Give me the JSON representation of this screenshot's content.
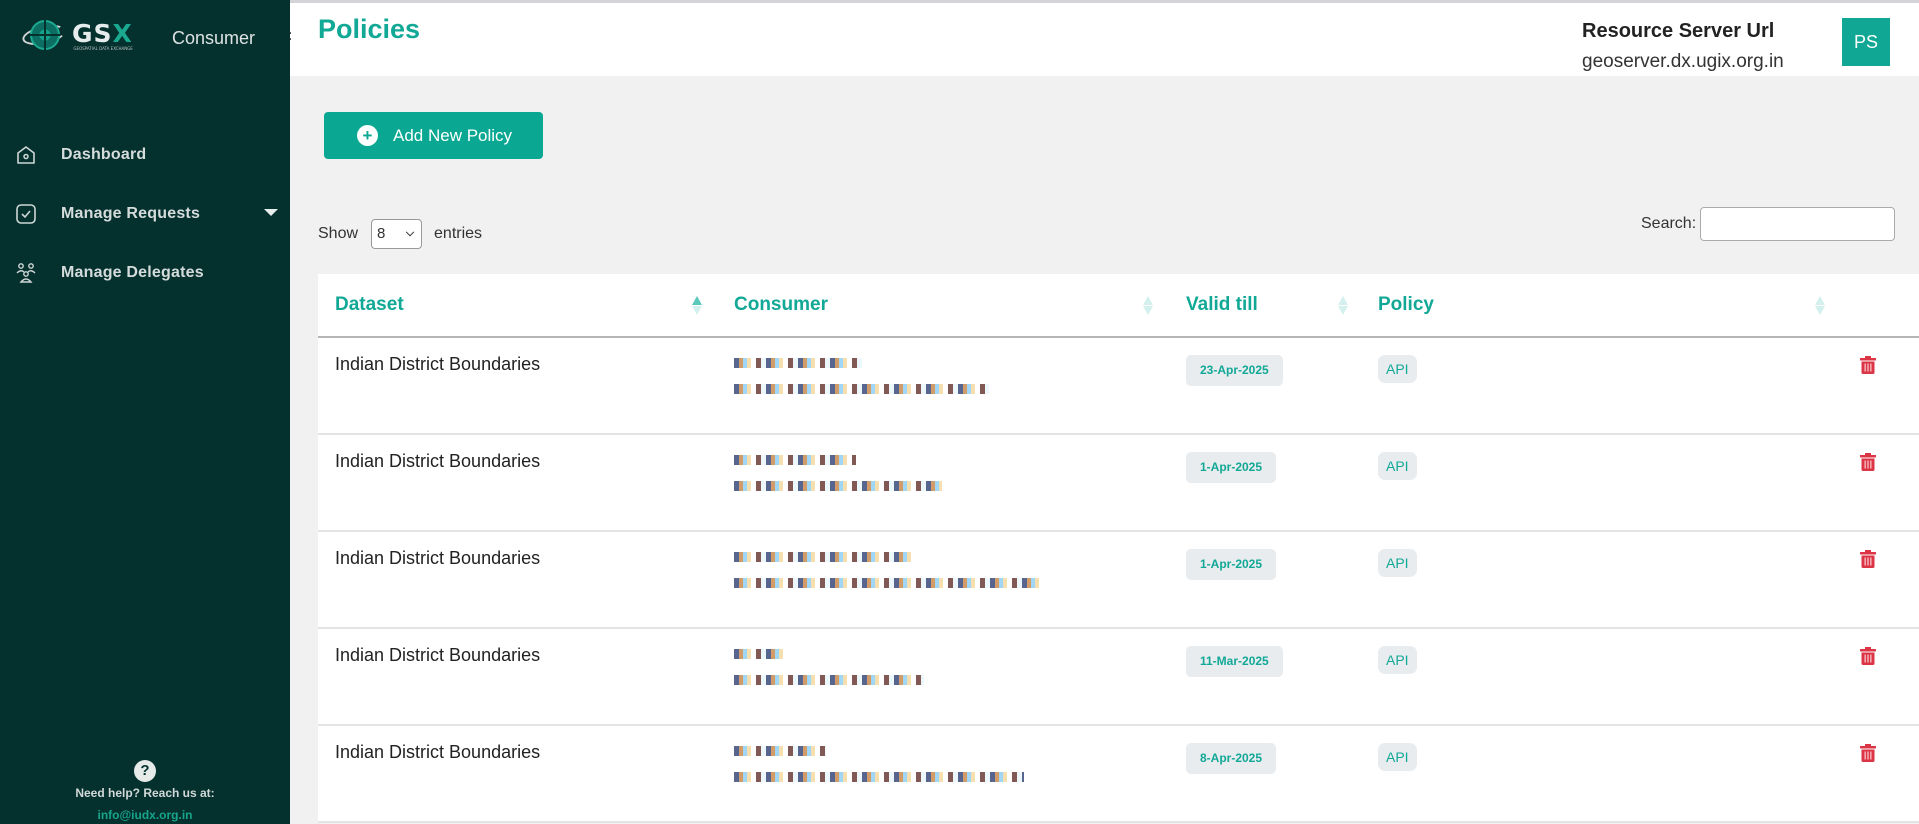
{
  "sidebar": {
    "logo_text": "GSX",
    "logo_subtext": "Geospatial Data Exchange",
    "role": "Consumer",
    "items": [
      {
        "label": "Dashboard",
        "icon": "home-icon"
      },
      {
        "label": "Manage Requests",
        "icon": "checkbox-icon",
        "has_dropdown": true
      },
      {
        "label": "Manage Delegates",
        "icon": "users-group-icon"
      }
    ],
    "help": {
      "icon": "question-icon",
      "text": "Need help? Reach us at:",
      "email": "info@iudx.org.in"
    }
  },
  "header": {
    "title": "Policies",
    "resource_server_label": "Resource Server Url",
    "resource_server_url": "geoserver.dx.ugix.org.in",
    "avatar_initials": "PS"
  },
  "toolbar": {
    "add_button_label": "Add New Policy",
    "show_label": "Show",
    "entries_value": "8",
    "entries_label": "entries",
    "search_label": "Search:",
    "search_value": ""
  },
  "table": {
    "columns": [
      {
        "label": "Dataset",
        "sort": "asc"
      },
      {
        "label": "Consumer",
        "sort": "none"
      },
      {
        "label": "Valid till",
        "sort": "none"
      },
      {
        "label": "Policy",
        "sort": "none"
      }
    ],
    "rows": [
      {
        "dataset": "Indian District Boundaries",
        "consumer": "[redacted]",
        "valid_till": "23-Apr-2025",
        "policy": "API"
      },
      {
        "dataset": "Indian District Boundaries",
        "consumer": "[redacted]",
        "valid_till": "1-Apr-2025",
        "policy": "API"
      },
      {
        "dataset": "Indian District Boundaries",
        "consumer": "[redacted]",
        "valid_till": "1-Apr-2025",
        "policy": "API"
      },
      {
        "dataset": "Indian District Boundaries",
        "consumer": "[redacted]",
        "valid_till": "11-Mar-2025",
        "policy": "API"
      },
      {
        "dataset": "Indian District Boundaries",
        "consumer": "[redacted]",
        "valid_till": "8-Apr-2025",
        "policy": "API"
      }
    ]
  },
  "colors": {
    "sidebar_bg": "#04302e",
    "accent": "#0aa892",
    "delete": "#dc3545"
  }
}
